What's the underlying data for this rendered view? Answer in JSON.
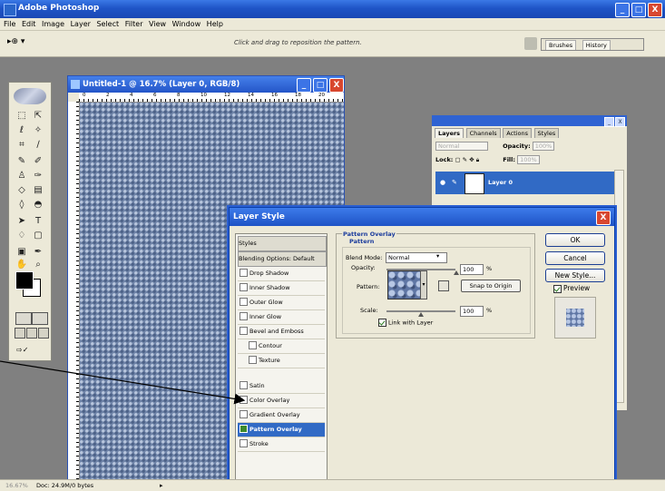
{
  "app": {
    "title": "Adobe Photoshop",
    "window_buttons": [
      "_",
      "□",
      "X"
    ]
  },
  "menu": [
    "File",
    "Edit",
    "Image",
    "Layer",
    "Select",
    "Filter",
    "View",
    "Window",
    "Help"
  ],
  "options": {
    "tool_preset": "▸⊕ ▾",
    "hint": "Click and drag to reposition the pattern.",
    "well_tabs": [
      "Brushes",
      "History"
    ]
  },
  "document": {
    "title": "Untitled-1 @ 16.7% (Layer 0, RGB/8)",
    "ruler_labels": [
      "0",
      "2",
      "4",
      "6",
      "8",
      "10",
      "12",
      "14",
      "16",
      "18",
      "20"
    ]
  },
  "layers_palette": {
    "tabs": [
      "Layers",
      "Channels",
      "Actions",
      "Styles"
    ],
    "blend_mode": "Normal",
    "opacity_label": "Opacity:",
    "opacity_value": "100%",
    "lock_label": "Lock:",
    "fill_label": "Fill:",
    "fill_value": "100%",
    "layer_name": "Layer 0"
  },
  "dialog": {
    "title": "Layer Style",
    "styles": [
      {
        "label": "Styles",
        "kind": "head"
      },
      {
        "label": "Blending Options: Default",
        "kind": "head"
      },
      {
        "label": "Drop Shadow",
        "kind": "item"
      },
      {
        "label": "Inner Shadow",
        "kind": "item"
      },
      {
        "label": "Outer Glow",
        "kind": "item"
      },
      {
        "label": "Inner Glow",
        "kind": "item"
      },
      {
        "label": "Bevel and Emboss",
        "kind": "item"
      },
      {
        "label": "Contour",
        "kind": "sub"
      },
      {
        "label": "Texture",
        "kind": "sub"
      },
      {
        "label": "Satin",
        "kind": "item"
      },
      {
        "label": "Color Overlay",
        "kind": "item"
      },
      {
        "label": "Gradient Overlay",
        "kind": "item"
      },
      {
        "label": "Pattern Overlay",
        "kind": "selected"
      },
      {
        "label": "Stroke",
        "kind": "item"
      }
    ],
    "section_title": "Pattern Overlay",
    "section_subtitle": "Pattern",
    "blend_mode_label": "Blend Mode:",
    "blend_mode_value": "Normal",
    "opacity_label": "Opacity:",
    "opacity_value": "100",
    "percent": "%",
    "pattern_label": "Pattern:",
    "snap_button": "Snap to Origin",
    "scale_label": "Scale:",
    "scale_value": "100",
    "link_label": "Link with Layer",
    "ok_button": "OK",
    "cancel_button": "Cancel",
    "new_style_button": "New Style...",
    "preview_label": "Preview"
  },
  "status": {
    "zoom": "16.67%",
    "doc": "Doc: 24.9M/0 bytes",
    "arrow": "▸"
  },
  "colors": {
    "title_blue": "#2455c8",
    "selection": "#316ac5",
    "workspace": "#808080",
    "pattern": "#6f84a8"
  }
}
